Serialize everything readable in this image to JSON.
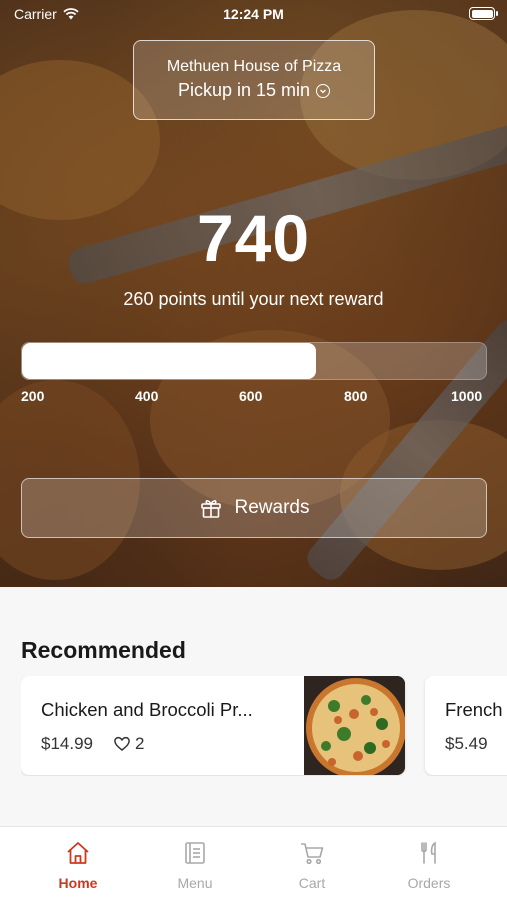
{
  "status_bar": {
    "carrier": "Carrier",
    "time": "12:24 PM"
  },
  "store": {
    "name": "Methuen House of Pizza",
    "pickup": "Pickup in 15 min"
  },
  "points": {
    "value": "740",
    "until_next": "260 points until your next reward",
    "progress_fraction": 0.634
  },
  "progress_ticks": [
    "200",
    "400",
    "600",
    "800",
    "1000"
  ],
  "rewards_button": {
    "label": "Rewards",
    "icon": "gift-icon"
  },
  "recommended": {
    "title": "Recommended",
    "items": [
      {
        "name": "Chicken and Broccoli Pr...",
        "price": "$14.99",
        "likes": "2"
      },
      {
        "name": "French",
        "price": "$5.49"
      }
    ]
  },
  "tabs": [
    {
      "label": "Home",
      "icon": "home-icon",
      "active": true
    },
    {
      "label": "Menu",
      "icon": "menu-book-icon",
      "active": false
    },
    {
      "label": "Cart",
      "icon": "cart-icon",
      "active": false
    },
    {
      "label": "Orders",
      "icon": "fork-knife-icon",
      "active": false
    }
  ],
  "colors": {
    "accent": "#cc3a1e",
    "inactive_tab": "#a8a8a8"
  }
}
